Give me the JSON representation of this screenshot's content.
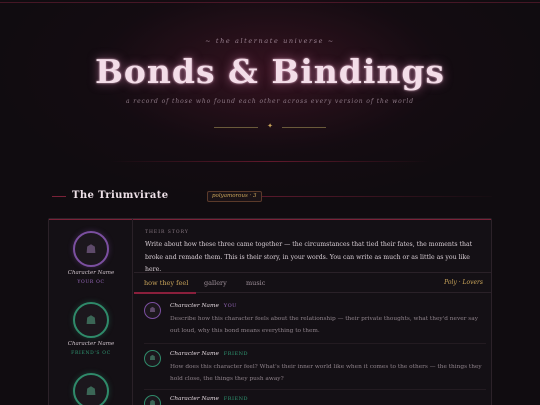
{
  "header": {
    "kicker": "~ the alternate universe ~",
    "title": "Bonds & Bindings",
    "subtitle": "a record of those who found each other across every version of the world",
    "ornament_icon": "star-icon"
  },
  "section": {
    "name": "The Triumvirate",
    "badge": "polyamorous · 3"
  },
  "roster": [
    {
      "name": "Character Name",
      "tag": "YOUR OC",
      "color": "#7b4fa0"
    },
    {
      "name": "Character Name",
      "tag": "FRIEND'S OC",
      "color": "#2f8a6a"
    },
    {
      "name": "Character Name",
      "tag": "",
      "color": "#2f8a6a"
    }
  ],
  "story": {
    "label": "THEIR STORY",
    "text": "Write about how these three came together — the circumstances that tied their fates, the moments that broke and remade them. This is their story, in your words. You can write as much or as little as you like here."
  },
  "tabs": {
    "items": [
      "how they feel",
      "gallery",
      "music"
    ],
    "active": "how they feel",
    "mode": "Poly · Lovers"
  },
  "entries": [
    {
      "name": "Character Name",
      "role": "YOU",
      "text": "Describe how this character feels about the relationship — their private thoughts, what they'd never say out loud, why this bond means everything to them."
    },
    {
      "name": "Character Name",
      "role": "FRIEND",
      "text": "How does this character feel? What's their inner world like when it comes to the others — the things they hold close, the things they push away?"
    },
    {
      "name": "Character Name",
      "role": "FRIEND",
      "text": ""
    }
  ],
  "colors": {
    "accent_crimson": "#8a1f3c",
    "accent_gold": "#c9a45a",
    "purple": "#7b4fa0",
    "teal": "#2f8a6a"
  }
}
